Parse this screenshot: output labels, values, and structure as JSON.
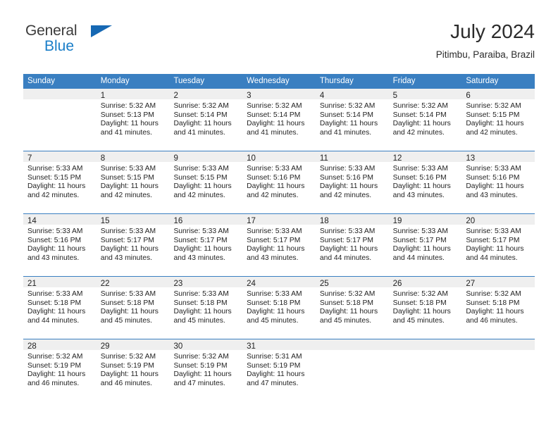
{
  "brand": {
    "name_part1": "General",
    "name_part2": "Blue",
    "triangle_color": "#1668b3",
    "blue_color": "#1a7ec8"
  },
  "header": {
    "title": "July 2024",
    "location": "Pitimbu, Paraiba, Brazil"
  },
  "theme": {
    "header_blue": "#3a7fc1",
    "daynum_band": "#efefef",
    "text": "#232323"
  },
  "calendar": {
    "weekdays": [
      "Sunday",
      "Monday",
      "Tuesday",
      "Wednesday",
      "Thursday",
      "Friday",
      "Saturday"
    ],
    "weeks": [
      [
        {
          "day": "",
          "sunrise": "",
          "sunset": "",
          "daylight1": "",
          "daylight2": ""
        },
        {
          "day": "1",
          "sunrise": "Sunrise: 5:32 AM",
          "sunset": "Sunset: 5:13 PM",
          "daylight1": "Daylight: 11 hours",
          "daylight2": "and 41 minutes."
        },
        {
          "day": "2",
          "sunrise": "Sunrise: 5:32 AM",
          "sunset": "Sunset: 5:14 PM",
          "daylight1": "Daylight: 11 hours",
          "daylight2": "and 41 minutes."
        },
        {
          "day": "3",
          "sunrise": "Sunrise: 5:32 AM",
          "sunset": "Sunset: 5:14 PM",
          "daylight1": "Daylight: 11 hours",
          "daylight2": "and 41 minutes."
        },
        {
          "day": "4",
          "sunrise": "Sunrise: 5:32 AM",
          "sunset": "Sunset: 5:14 PM",
          "daylight1": "Daylight: 11 hours",
          "daylight2": "and 41 minutes."
        },
        {
          "day": "5",
          "sunrise": "Sunrise: 5:32 AM",
          "sunset": "Sunset: 5:14 PM",
          "daylight1": "Daylight: 11 hours",
          "daylight2": "and 42 minutes."
        },
        {
          "day": "6",
          "sunrise": "Sunrise: 5:32 AM",
          "sunset": "Sunset: 5:15 PM",
          "daylight1": "Daylight: 11 hours",
          "daylight2": "and 42 minutes."
        }
      ],
      [
        {
          "day": "7",
          "sunrise": "Sunrise: 5:33 AM",
          "sunset": "Sunset: 5:15 PM",
          "daylight1": "Daylight: 11 hours",
          "daylight2": "and 42 minutes."
        },
        {
          "day": "8",
          "sunrise": "Sunrise: 5:33 AM",
          "sunset": "Sunset: 5:15 PM",
          "daylight1": "Daylight: 11 hours",
          "daylight2": "and 42 minutes."
        },
        {
          "day": "9",
          "sunrise": "Sunrise: 5:33 AM",
          "sunset": "Sunset: 5:15 PM",
          "daylight1": "Daylight: 11 hours",
          "daylight2": "and 42 minutes."
        },
        {
          "day": "10",
          "sunrise": "Sunrise: 5:33 AM",
          "sunset": "Sunset: 5:16 PM",
          "daylight1": "Daylight: 11 hours",
          "daylight2": "and 42 minutes."
        },
        {
          "day": "11",
          "sunrise": "Sunrise: 5:33 AM",
          "sunset": "Sunset: 5:16 PM",
          "daylight1": "Daylight: 11 hours",
          "daylight2": "and 42 minutes."
        },
        {
          "day": "12",
          "sunrise": "Sunrise: 5:33 AM",
          "sunset": "Sunset: 5:16 PM",
          "daylight1": "Daylight: 11 hours",
          "daylight2": "and 43 minutes."
        },
        {
          "day": "13",
          "sunrise": "Sunrise: 5:33 AM",
          "sunset": "Sunset: 5:16 PM",
          "daylight1": "Daylight: 11 hours",
          "daylight2": "and 43 minutes."
        }
      ],
      [
        {
          "day": "14",
          "sunrise": "Sunrise: 5:33 AM",
          "sunset": "Sunset: 5:16 PM",
          "daylight1": "Daylight: 11 hours",
          "daylight2": "and 43 minutes."
        },
        {
          "day": "15",
          "sunrise": "Sunrise: 5:33 AM",
          "sunset": "Sunset: 5:17 PM",
          "daylight1": "Daylight: 11 hours",
          "daylight2": "and 43 minutes."
        },
        {
          "day": "16",
          "sunrise": "Sunrise: 5:33 AM",
          "sunset": "Sunset: 5:17 PM",
          "daylight1": "Daylight: 11 hours",
          "daylight2": "and 43 minutes."
        },
        {
          "day": "17",
          "sunrise": "Sunrise: 5:33 AM",
          "sunset": "Sunset: 5:17 PM",
          "daylight1": "Daylight: 11 hours",
          "daylight2": "and 43 minutes."
        },
        {
          "day": "18",
          "sunrise": "Sunrise: 5:33 AM",
          "sunset": "Sunset: 5:17 PM",
          "daylight1": "Daylight: 11 hours",
          "daylight2": "and 44 minutes."
        },
        {
          "day": "19",
          "sunrise": "Sunrise: 5:33 AM",
          "sunset": "Sunset: 5:17 PM",
          "daylight1": "Daylight: 11 hours",
          "daylight2": "and 44 minutes."
        },
        {
          "day": "20",
          "sunrise": "Sunrise: 5:33 AM",
          "sunset": "Sunset: 5:17 PM",
          "daylight1": "Daylight: 11 hours",
          "daylight2": "and 44 minutes."
        }
      ],
      [
        {
          "day": "21",
          "sunrise": "Sunrise: 5:33 AM",
          "sunset": "Sunset: 5:18 PM",
          "daylight1": "Daylight: 11 hours",
          "daylight2": "and 44 minutes."
        },
        {
          "day": "22",
          "sunrise": "Sunrise: 5:33 AM",
          "sunset": "Sunset: 5:18 PM",
          "daylight1": "Daylight: 11 hours",
          "daylight2": "and 45 minutes."
        },
        {
          "day": "23",
          "sunrise": "Sunrise: 5:33 AM",
          "sunset": "Sunset: 5:18 PM",
          "daylight1": "Daylight: 11 hours",
          "daylight2": "and 45 minutes."
        },
        {
          "day": "24",
          "sunrise": "Sunrise: 5:33 AM",
          "sunset": "Sunset: 5:18 PM",
          "daylight1": "Daylight: 11 hours",
          "daylight2": "and 45 minutes."
        },
        {
          "day": "25",
          "sunrise": "Sunrise: 5:32 AM",
          "sunset": "Sunset: 5:18 PM",
          "daylight1": "Daylight: 11 hours",
          "daylight2": "and 45 minutes."
        },
        {
          "day": "26",
          "sunrise": "Sunrise: 5:32 AM",
          "sunset": "Sunset: 5:18 PM",
          "daylight1": "Daylight: 11 hours",
          "daylight2": "and 45 minutes."
        },
        {
          "day": "27",
          "sunrise": "Sunrise: 5:32 AM",
          "sunset": "Sunset: 5:18 PM",
          "daylight1": "Daylight: 11 hours",
          "daylight2": "and 46 minutes."
        }
      ],
      [
        {
          "day": "28",
          "sunrise": "Sunrise: 5:32 AM",
          "sunset": "Sunset: 5:19 PM",
          "daylight1": "Daylight: 11 hours",
          "daylight2": "and 46 minutes."
        },
        {
          "day": "29",
          "sunrise": "Sunrise: 5:32 AM",
          "sunset": "Sunset: 5:19 PM",
          "daylight1": "Daylight: 11 hours",
          "daylight2": "and 46 minutes."
        },
        {
          "day": "30",
          "sunrise": "Sunrise: 5:32 AM",
          "sunset": "Sunset: 5:19 PM",
          "daylight1": "Daylight: 11 hours",
          "daylight2": "and 47 minutes."
        },
        {
          "day": "31",
          "sunrise": "Sunrise: 5:31 AM",
          "sunset": "Sunset: 5:19 PM",
          "daylight1": "Daylight: 11 hours",
          "daylight2": "and 47 minutes."
        },
        {
          "day": "",
          "sunrise": "",
          "sunset": "",
          "daylight1": "",
          "daylight2": ""
        },
        {
          "day": "",
          "sunrise": "",
          "sunset": "",
          "daylight1": "",
          "daylight2": ""
        },
        {
          "day": "",
          "sunrise": "",
          "sunset": "",
          "daylight1": "",
          "daylight2": ""
        }
      ]
    ]
  }
}
